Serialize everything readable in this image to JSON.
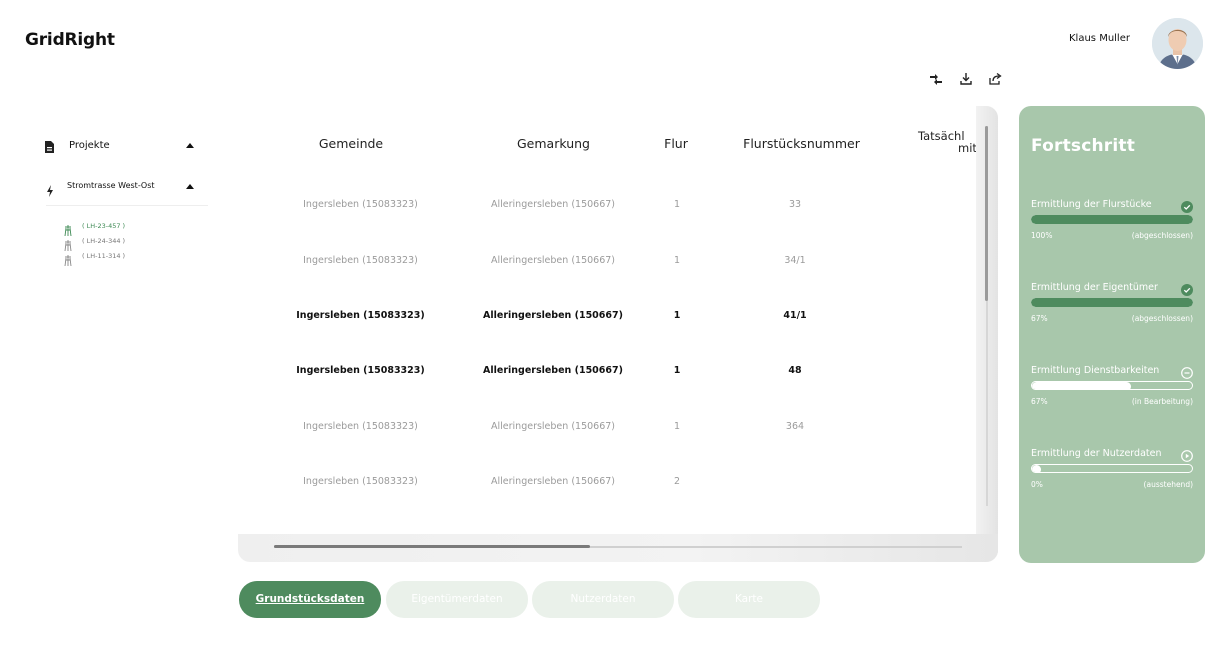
{
  "app": {
    "logo": "GridRight"
  },
  "user": {
    "name": "Klaus Muller"
  },
  "toolbar": {
    "icons": [
      "transfer-icon",
      "download-icon",
      "share-icon"
    ]
  },
  "sidebar": {
    "projects_label": "Projekte",
    "project": {
      "label": "Stromtrasse West-Ost"
    },
    "sub_items": [
      {
        "label": "( LH-23-457 )",
        "active": true
      },
      {
        "label": "( LH-24-344 )",
        "active": false
      },
      {
        "label": "( LH-11-314 )",
        "active": false
      }
    ]
  },
  "table": {
    "headers": {
      "gemeinde": "Gemeinde",
      "gemarkung": "Gemarkung",
      "flur": "Flur",
      "nummer": "Flurstücksnummer",
      "tats_line1": "Tatsächl",
      "tats_line2": "mit"
    },
    "rows": [
      {
        "gemeinde": "Ingersleben (15083323)",
        "gemarkung": "Alleringersleben (150667)",
        "flur": "1",
        "nummer": "33",
        "bold": false
      },
      {
        "gemeinde": "Ingersleben (15083323)",
        "gemarkung": "Alleringersleben (150667)",
        "flur": "1",
        "nummer": "34/1",
        "bold": false
      },
      {
        "gemeinde": "Ingersleben (15083323)",
        "gemarkung": "Alleringersleben (150667)",
        "flur": "1",
        "nummer": "41/1",
        "bold": true
      },
      {
        "gemeinde": "Ingersleben (15083323)",
        "gemarkung": "Alleringersleben (150667)",
        "flur": "1",
        "nummer": "48",
        "bold": true
      },
      {
        "gemeinde": "Ingersleben (15083323)",
        "gemarkung": "Alleringersleben (150667)",
        "flur": "1",
        "nummer": "364",
        "bold": false
      },
      {
        "gemeinde": "Ingersleben (15083323)",
        "gemarkung": "Alleringersleben (150667)",
        "flur": "2",
        "nummer": "",
        "bold": false
      }
    ]
  },
  "tabs": [
    {
      "label": "Grundstücksdaten",
      "active": true
    },
    {
      "label": "Eigentümerdaten",
      "active": false
    },
    {
      "label": "Nutzerdaten",
      "active": false
    },
    {
      "label": "Karte",
      "active": false
    }
  ],
  "progress": {
    "title": "Fortschritt",
    "items": [
      {
        "label": "Ermittlung der Flurstücke",
        "percent_text": "100%",
        "state": "(abgeschlossen)",
        "fill_fraction": 1.0,
        "icon": "check-circle-icon"
      },
      {
        "label": "Ermittlung der Eigentümer",
        "percent_text": "67%",
        "state": "(abgeschlossen)",
        "fill_fraction": 1.0,
        "icon": "check-circle-icon"
      },
      {
        "label": "Ermittlung Dienstbarkeiten",
        "percent_text": "67%",
        "state": "(in Bearbeitung)",
        "fill_fraction": 0.62,
        "icon": "minus-circle-icon"
      },
      {
        "label": "Ermittlung der Nutzerdaten",
        "percent_text": "0%",
        "state": "(ausstehend)",
        "fill_fraction": 0.0,
        "icon": "play-circle-icon"
      }
    ],
    "colors": {
      "done": "#4e8b5e",
      "in_progress": "#ffffff",
      "empty": "#ffffff",
      "knob": "#ffffff"
    }
  }
}
